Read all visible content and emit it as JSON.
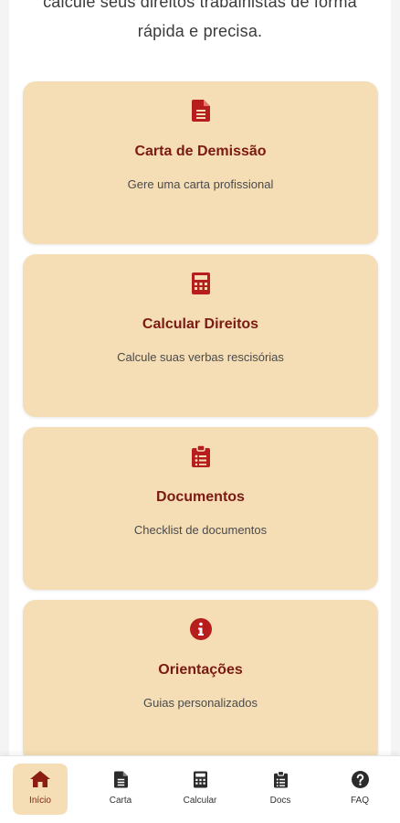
{
  "intro": {
    "line1": "calcule seus direitos trabalhistas de forma",
    "line2": "rápida e precisa."
  },
  "cards": [
    {
      "icon": "document-icon",
      "title": "Carta de Demissão",
      "desc": "Gere uma carta profissional"
    },
    {
      "icon": "calculator-icon",
      "title": "Calcular Direitos",
      "desc": "Calcule suas verbas rescisórias"
    },
    {
      "icon": "clipboard-list-icon",
      "title": "Documentos",
      "desc": "Checklist de documentos"
    },
    {
      "icon": "info-circle-icon",
      "title": "Orientações",
      "desc": "Guias personalizados"
    }
  ],
  "nav": [
    {
      "label": "Início",
      "icon": "home-icon",
      "active": true
    },
    {
      "label": "Carta",
      "icon": "document-icon",
      "active": false
    },
    {
      "label": "Calcular",
      "icon": "calculator-icon",
      "active": false
    },
    {
      "label": "Docs",
      "icon": "clipboard-icon",
      "active": false
    },
    {
      "label": "FAQ",
      "icon": "question-circle-icon",
      "active": false
    }
  ],
  "colors": {
    "card_bg": "#f5deb6",
    "accent": "#b81d1d",
    "title": "#7b1a12"
  }
}
